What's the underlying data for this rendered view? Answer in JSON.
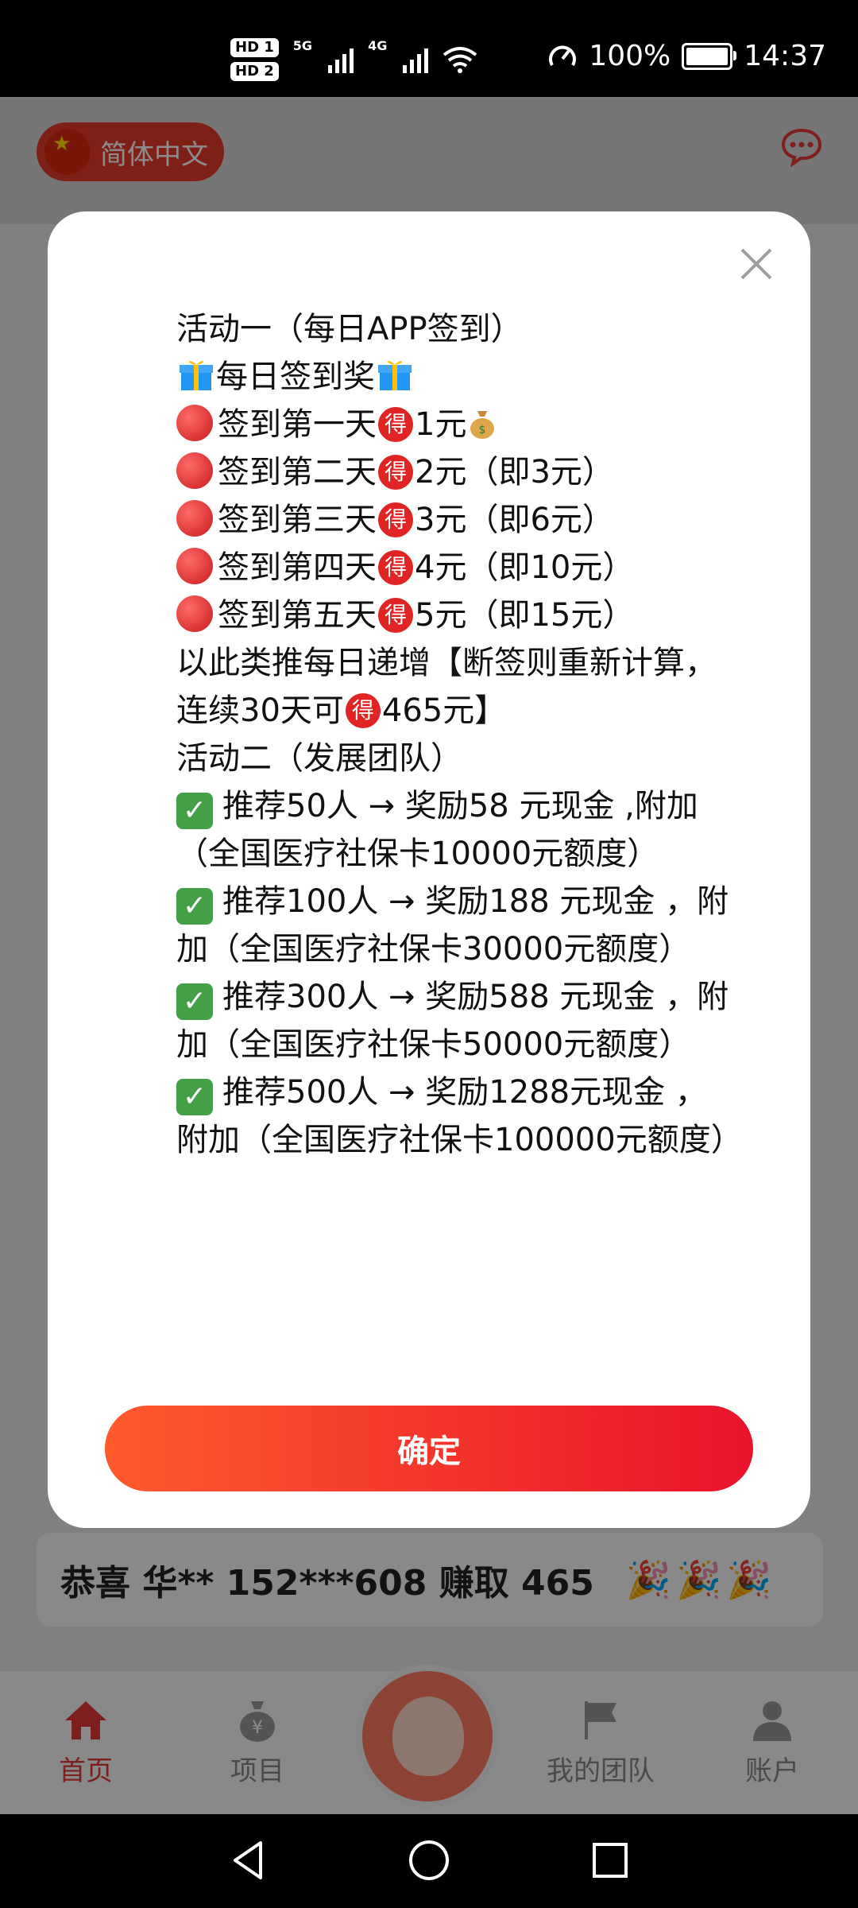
{
  "status_bar": {
    "hd1": "HD 1",
    "hd2": "HD 2",
    "net1": "5G",
    "net2": "4G",
    "battery_percent": "100%",
    "battery_level": 1.0,
    "time": "14:37"
  },
  "header": {
    "language": "简体中文"
  },
  "modal": {
    "lines": [
      "活动一（每日APP签到）",
      "每日签到奖",
      "签到第一天",
      "1元",
      "签到第二天",
      "2元（即3元）",
      "签到第三天",
      "3元（即6元）",
      "签到第四天",
      "4元（即10元）",
      "签到第五天",
      "5元（即15元）",
      "以此类推每日递增【断签则重新计算，连续30天可",
      "465元】",
      "活动二（发展团队）",
      "推荐50人 → 奖励58 元现金 ,附加（全国医疗社保卡10000元额度）",
      "推荐100人 → 奖励188 元现金 ，附加（全国医疗社保卡30000元额度）",
      "推荐300人 → 奖励588 元现金 ，附加（全国医疗社保卡50000元额度）",
      "推荐500人 → 奖励1288元现金 ，附加（全国医疗社保卡100000元额度）"
    ],
    "de_char": "得",
    "check_char": "✓",
    "confirm_label": "确定"
  },
  "ticker": {
    "text": "恭喜 华** 152***608 赚取 465",
    "decoration": "🎉🎉🎉"
  },
  "bottom_nav": {
    "items": [
      {
        "label": "首页",
        "icon": "home-icon"
      },
      {
        "label": "项目",
        "icon": "money-bag-icon"
      },
      {
        "label": "",
        "icon": "customer-service-avatar"
      },
      {
        "label": "我的团队",
        "icon": "flag-icon"
      },
      {
        "label": "账户",
        "icon": "user-icon"
      }
    ]
  },
  "colors": {
    "accent": "#e53935",
    "button_gradient_start": "#ff5a2c",
    "button_gradient_end": "#e8132c"
  }
}
